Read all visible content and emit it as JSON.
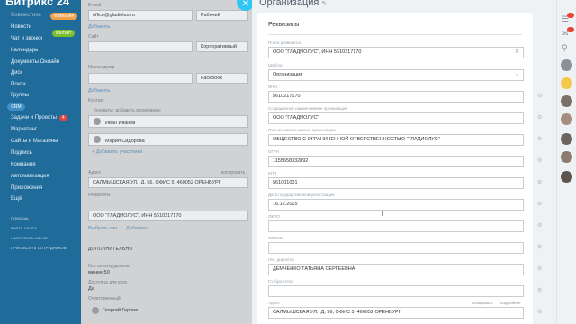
{
  "sidebar": {
    "brand": "Битрикс 24",
    "items": [
      "Совместное",
      "Новости",
      "Чат и звонки",
      "Календарь",
      "Документы Онлайн",
      "Диск",
      "Почта",
      "Группы"
    ],
    "section_label": "CRM",
    "crm_items": [
      "Задачи и Проекты",
      "Маркетинг",
      "Сайты и Магазины",
      "Подпись",
      "Компания",
      "Автоматизация",
      "Приложения",
      "Ещё"
    ],
    "tasks_badge": "4",
    "small_links": [
      "помощь",
      "карта сайта",
      "настроить меню",
      "пригласить сотрудников"
    ],
    "tag_company": "компания",
    "tag_contact": "контакт"
  },
  "background": {
    "email_label": "E-mail",
    "email_value": "office@gladiolus.ru",
    "email_type": "Рабочий",
    "add_link": "Добавить",
    "site_label": "Сайт",
    "site_type": "Корпоративный",
    "messenger_label": "Мессенджер",
    "messenger_type": "Facebook",
    "contacts_label": "Контакт",
    "contacts_hint": "Контакты: добавить в компанию",
    "contact1": "Иван Иванов",
    "contact2": "Мария Сидорова",
    "add_participant": "+ Добавить участника",
    "address_label": "Адрес",
    "copy_label": "копировать",
    "address_value": "САЛМЫШСКАЯ УЛ., Д. 56, ОФИС 5, 460052 ОРЕНБУРГ",
    "rekv_label": "Реквизиты",
    "rekv_value": "ООО \"ГЛАДИОЛУС\", ИНН 5610217170",
    "choose_link": "Выбрать тип",
    "add_link2": "Добавить",
    "additional": "ДОПОЛНИТЕЛЬНО",
    "employees_label": "Кол-во сотрудников",
    "employees_value": "менее 50",
    "access_label": "Доступна для всех",
    "access_value": "Да",
    "responsible_label": "Ответственный",
    "responsible_value": "Георгий Героев"
  },
  "panel": {
    "title": "Организация",
    "card_title": "Реквизиты",
    "fields": [
      {
        "label": "Поиск реквизитов",
        "value": "ООО \"ГЛАДИОЛУС\", ИНН 5610217170",
        "icon": "x"
      },
      {
        "label": "Шаблон",
        "value": "Организация",
        "icon": "chevron"
      },
      {
        "label": "ИНН",
        "value": "5610217170",
        "icon": ""
      },
      {
        "label": "Сокращенное наименование организации",
        "value": "ООО \"ГЛАДИОЛУС\"",
        "icon": ""
      },
      {
        "label": "Полное наименование организации",
        "value": "ОБЩЕСТВО С ОГРАНИЧЕННОЙ ОТВЕТСТВЕННОСТЬЮ \"ГЛАДИОЛУС\"",
        "icon": ""
      },
      {
        "label": "ОГРН",
        "value": "1155658032892",
        "icon": ""
      },
      {
        "label": "КПП",
        "value": "561001001",
        "icon": ""
      },
      {
        "label": "Дата государственной регистрации",
        "value": "16.12.2015",
        "icon": ""
      },
      {
        "label": "ОКПО",
        "value": "",
        "icon": ""
      },
      {
        "label": "ОКТМО",
        "value": "",
        "icon": ""
      },
      {
        "label": "Ген. директор",
        "value": "ДЕМЧЕНКО ТАТЬЯНА СЕРГЕЕВНА",
        "icon": ""
      },
      {
        "label": "Гл. бухгалтер",
        "value": "",
        "icon": ""
      },
      {
        "label": "Адрес",
        "value": "САЛМЫШСКАЯ УЛ., Д. 56, ОФИС 5, 460052 ОРЕНБУРГ",
        "icon": ""
      }
    ],
    "copy_label": "копировать",
    "detail_label": "подробнее"
  },
  "colors": {
    "sidebar": "#1f6b9a",
    "accent": "#2fc6f6",
    "tag_company": "#f0a14b",
    "tag_contact": "#7bbf2d",
    "badge": "#e8443a"
  }
}
